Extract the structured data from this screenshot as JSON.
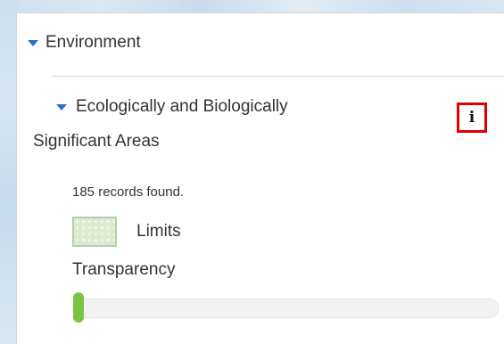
{
  "section": {
    "label": "Environment"
  },
  "layer": {
    "title_line1": "Ecologically and Biologically",
    "title_line2": "Significant Areas",
    "info_icon_glyph": "i",
    "records_text": "185 records found.",
    "legend_label": "Limits",
    "transparency_label": "Transparency",
    "transparency_value": 0
  },
  "colors": {
    "accent_triangle": "#2a6fc9",
    "info_highlight": "#e00000",
    "slider_thumb": "#7cc243",
    "legend_fill": "#dbead0"
  },
  "icons": {
    "section_toggle": "caret-down-icon",
    "layer_toggle": "caret-down-icon",
    "info": "info-icon"
  }
}
